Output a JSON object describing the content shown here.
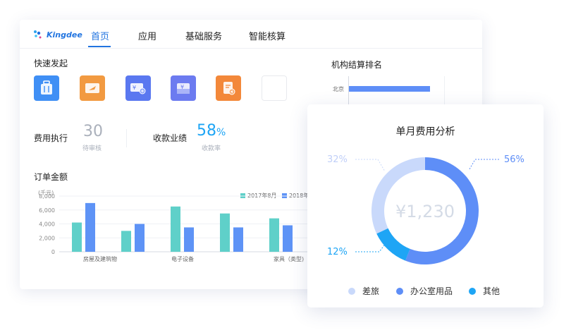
{
  "brand": {
    "name": "Kingdee"
  },
  "nav": {
    "items": [
      "首页",
      "应用",
      "基础服务",
      "智能核算"
    ],
    "active_index": 0
  },
  "quick_actions": {
    "title": "快速发起",
    "icons": [
      {
        "name": "luggage-icon",
        "color": "#3f8ff5"
      },
      {
        "name": "plane-ticket-icon",
        "color": "#f29a41"
      },
      {
        "name": "yen-ticket-icon",
        "color": "#5a78f0"
      },
      {
        "name": "yen-card-icon",
        "color": "#6c7bf0"
      },
      {
        "name": "document-return-icon",
        "color": "#f3883a"
      }
    ]
  },
  "stats": {
    "expense_exec": {
      "label": "费用执行",
      "value": "30",
      "sub": "待审核"
    },
    "collection": {
      "label": "收款业绩",
      "value": "58",
      "unit": "%",
      "sub": "收款率"
    }
  },
  "order_chart": {
    "title": "订单金额",
    "chart_data": {
      "type": "bar",
      "ylabel": "(千元)",
      "ylim": [
        0,
        8000
      ],
      "yticks": [
        "8,000",
        "6,000",
        "4,000",
        "2,000",
        "0"
      ],
      "x_tick_labels": [
        "房屋及建筑物",
        "电子设备",
        "家具（类型)"
      ],
      "series": [
        {
          "name": "2017年8月",
          "color": "#5fd0c9",
          "values": [
            4200,
            3000,
            6500,
            5500,
            4800
          ]
        },
        {
          "name": "2018年",
          "color": "#5e93f6",
          "values": [
            7000,
            4000,
            3500,
            3500,
            3800
          ]
        }
      ]
    }
  },
  "ranking": {
    "title": "机构结算排名",
    "chart_data": {
      "type": "bar",
      "categories": [
        "北京"
      ],
      "values": [
        0.6
      ]
    }
  },
  "monthly": {
    "title": "单月费用分析",
    "center_value": "¥1,230",
    "chart_data": {
      "type": "pie",
      "slices": [
        {
          "name": "差旅",
          "percent": 32,
          "label": "32%",
          "color": "#c9d9fb"
        },
        {
          "name": "办公室用品",
          "percent": 56,
          "label": "56%",
          "color": "#5e8ef7"
        },
        {
          "name": "其他",
          "percent": 12,
          "label": "12%",
          "color": "#1ea5f5"
        }
      ]
    }
  }
}
